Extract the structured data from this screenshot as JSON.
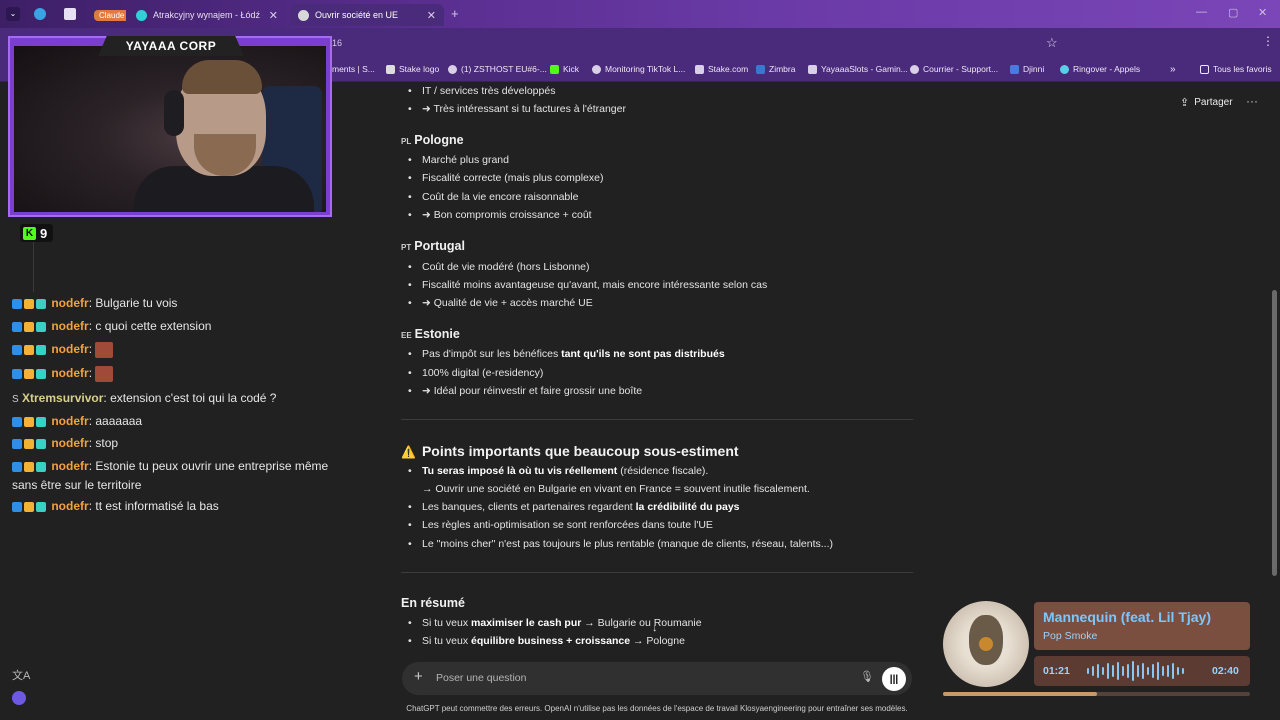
{
  "browser": {
    "tabs": [
      {
        "label": "Claude",
        "pill": true
      },
      {
        "label": "Atrakcyjny wynajem - Łódź - sp"
      },
      {
        "label": "Ouvrir société en UE",
        "active": true
      }
    ],
    "new_tab": "+",
    "address_fragment": "16",
    "bookmarks": [
      "ments | S...",
      "Stake logo",
      "(1) ZSTHOST EU#6-...",
      "Kick",
      "Monitoring TikTok L...",
      "Stake.com",
      "Zimbra",
      "YayaaaSlots - Gamin...",
      "Courrier - Support...",
      "Djinni",
      "Ringover - Appels"
    ],
    "all_bookmarks": "Tous les favoris"
  },
  "overlay": {
    "cam_title": "YAYAAA CORP",
    "kick_count": "9"
  },
  "chat": {
    "messages": [
      {
        "user": "nodefr",
        "sep": ":",
        "text": "Bulgarie tu vois"
      },
      {
        "user": "nodefr",
        "sep": ":",
        "text": "c quoi cette extension"
      },
      {
        "user": "nodefr",
        "sep": ":",
        "text": ""
      },
      {
        "user": "nodefr",
        "sep": ":",
        "text": ""
      },
      {
        "user": "Xtremsurvivor",
        "sep": ":",
        "text": "extension c'est toi qui la codé ?"
      },
      {
        "user": "nodefr",
        "sep": ":",
        "text": "aaaaaaa"
      },
      {
        "user": "nodefr",
        "sep": ":",
        "text": "stop"
      },
      {
        "user": "nodefr",
        "sep": ":",
        "text": "Estonie tu peux ouvrir une entreprise même sans être sur le territoire"
      },
      {
        "user": "nodefr",
        "sep": ":",
        "text": "tt est informatisé la bas"
      }
    ]
  },
  "doc": {
    "top_items": [
      "IT / services très développés",
      "➜ Très intéressant si tu factures à l'étranger"
    ],
    "pologne": {
      "code": "PL",
      "title": "Pologne",
      "items": [
        "Marché plus grand",
        "Fiscalité correcte (mais plus complexe)",
        "Coût de la vie encore raisonnable",
        "➜ Bon compromis croissance + coût"
      ]
    },
    "portugal": {
      "code": "PT",
      "title": "Portugal",
      "items": [
        "Coût de vie modéré (hors Lisbonne)",
        "Fiscalité moins avantageuse qu'avant, mais encore intéressante selon cas",
        "➜ Qualité de vie + accès marché UE"
      ]
    },
    "estonie": {
      "code": "EE",
      "title": "Estonie",
      "item1_pre": "Pas d'impôt sur les bénéfices ",
      "item1_bold": "tant qu'ils ne sont pas distribués",
      "item2": "100% digital (e-residency)",
      "item3": "➜ Idéal pour réinvestir et faire grossir une boîte"
    },
    "points": {
      "icon": "⚠️",
      "title": "Points importants que beaucoup sous-estiment",
      "i1_bold": "Tu seras imposé là où tu vis réellement",
      "i1_rest": " (résidence fiscale).",
      "i1_sub": "→ Ouvrir une société en Bulgarie en vivant en France = souvent inutile fiscalement.",
      "i2_pre": "Les banques, clients et partenaires regardent ",
      "i2_bold": "la crédibilité du pays",
      "i3": "Les règles anti-optimisation se sont renforcées dans toute l'UE",
      "i4": "Le \"moins cher\" n'est pas toujours le plus rentable (manque de clients, réseau, talents...)"
    },
    "resume": {
      "title": "En résumé",
      "r1_pre": "Si tu veux ",
      "r1_bold": "maximiser le cash pur",
      "r1_rest": " → Bulgarie ou Roumanie",
      "r2_pre": "Si tu veux ",
      "r2_bold": "équilibre business + croissance",
      "r2_rest": " → Pologne"
    }
  },
  "header": {
    "share": "Partager",
    "more": "···"
  },
  "composer": {
    "placeholder": "Poser une question",
    "disclaimer": "ChatGPT peut commettre des erreurs. OpenAI n'utilise pas les données de l'espace de travail Klosyaengineering pour entraîner ses modèles."
  },
  "music": {
    "title": "Mannequin (feat. Lil Tjay)",
    "artist": "Pop Smoke",
    "elapsed": "01:21",
    "total": "02:40",
    "progress": 0.5
  }
}
